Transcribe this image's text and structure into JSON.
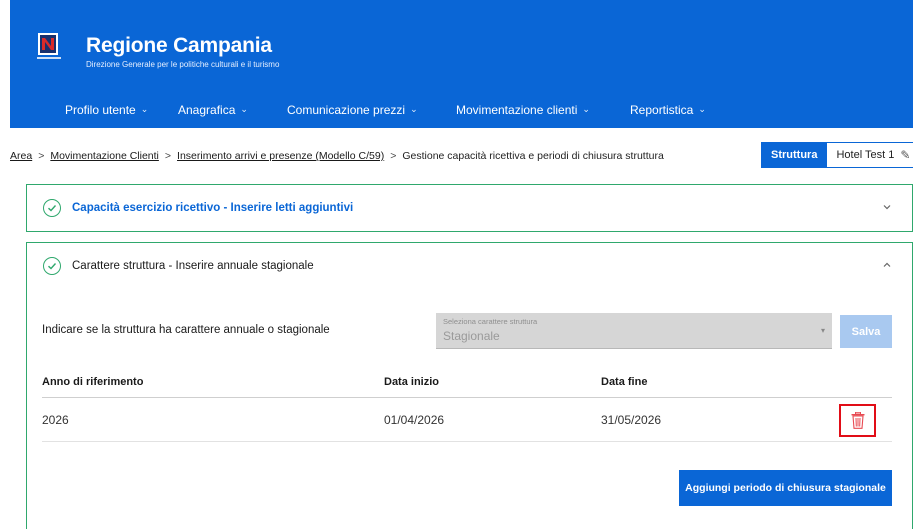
{
  "brand": {
    "title": "Regione Campania",
    "subtitle": "Direzione Generale per le politiche culturali e il turismo"
  },
  "nav": {
    "items": [
      {
        "label": "Profilo utente"
      },
      {
        "label": "Anagrafica"
      },
      {
        "label": "Comunicazione prezzi"
      },
      {
        "label": "Movimentazione clienti"
      },
      {
        "label": "Reportistica"
      }
    ]
  },
  "breadcrumb": {
    "items": [
      {
        "label": "Area"
      },
      {
        "label": "Movimentazione Clienti"
      },
      {
        "label": "Inserimento arrivi e presenze (Modello C/59)"
      },
      {
        "label": "Gestione capacità ricettiva e periodi di chiusura struttura"
      }
    ],
    "separator": ">"
  },
  "structure": {
    "label": "Struttura",
    "value": "Hotel Test 1"
  },
  "panels": {
    "capacity": {
      "title": "Capacità esercizio ricettivo - Inserire letti aggiuntivi"
    },
    "character": {
      "title": "Carattere struttura - Inserire annuale stagionale",
      "question": "Indicare se la struttura ha carattere annuale o stagionale",
      "select": {
        "placeholder": "Seleziona carattere struttura",
        "value": "Stagionale"
      },
      "save_label": "Salva",
      "table": {
        "headers": [
          "Anno di riferimento",
          "Data inizio",
          "Data fine"
        ],
        "rows": [
          [
            "2026",
            "01/04/2026",
            "31/05/2026"
          ]
        ]
      },
      "add_label": "Aggiungi periodo di chiusura stagionale"
    }
  },
  "colors": {
    "primary": "#0a66d6",
    "success": "#2fa86d",
    "danger": "#e10d17",
    "disabled_button": "#a9c9f0"
  }
}
